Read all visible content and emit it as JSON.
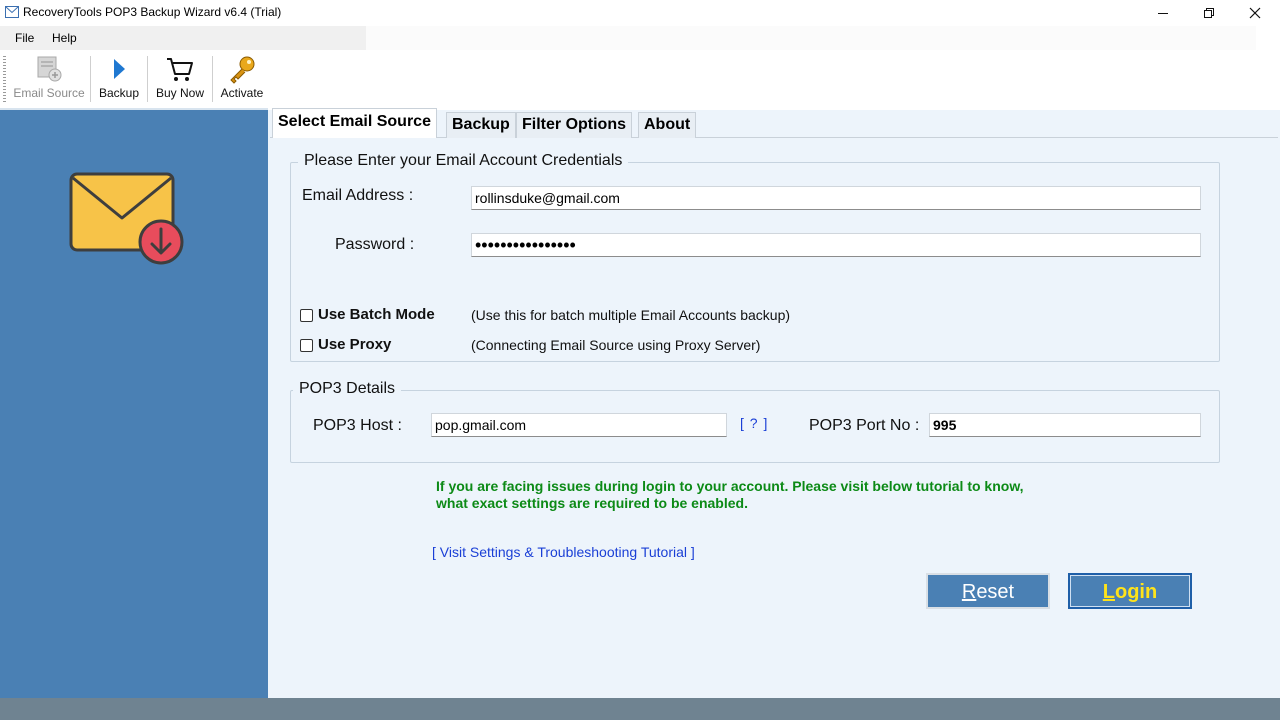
{
  "window": {
    "title": "RecoveryTools POP3 Backup Wizard v6.4 (Trial)",
    "min_symbol": "—",
    "max_symbol": "❐",
    "close_symbol": "✕"
  },
  "menu": {
    "file": "File",
    "help": "Help"
  },
  "toolbar": {
    "email_source": "Email Source",
    "backup": "Backup",
    "buy_now": "Buy Now",
    "activate": "Activate"
  },
  "tabs": {
    "select_email_source": "Select Email Source",
    "backup": "Backup",
    "filter_options": "Filter Options",
    "about": "About"
  },
  "credentials": {
    "group_title": "Please Enter your Email Account Credentials",
    "email_label": "Email Address :",
    "email_value": "rollinsduke@gmail.com",
    "password_label": "Password :",
    "password_value": "••••••••••••••••",
    "batch_label": "Use Batch Mode",
    "batch_hint": "(Use this for batch multiple Email Accounts backup)",
    "proxy_label": "Use Proxy",
    "proxy_hint": "(Connecting Email Source using Proxy Server)"
  },
  "pop3": {
    "group_title": "POP3 Details",
    "host_label": "POP3 Host :",
    "host_value": "pop.gmail.com",
    "help_link": "[ ? ]",
    "port_label": "POP3 Port No :",
    "port_value": "995"
  },
  "notice": {
    "line1": "If you are facing issues during login to your account. Please visit below tutorial to know,",
    "line2": "what exact settings are required to be enabled."
  },
  "tutorial_link": "[ Visit Settings & Troubleshooting Tutorial ]",
  "buttons": {
    "reset_rest": "eset",
    "reset_key": "R",
    "login_rest": "ogin",
    "login_key": "L"
  },
  "colors": {
    "sidebar": "#4a80b4",
    "main_bg": "#edf4fb",
    "notice": "#0c8a16",
    "link": "#1a3fd6",
    "login_text": "#ffe31a"
  }
}
